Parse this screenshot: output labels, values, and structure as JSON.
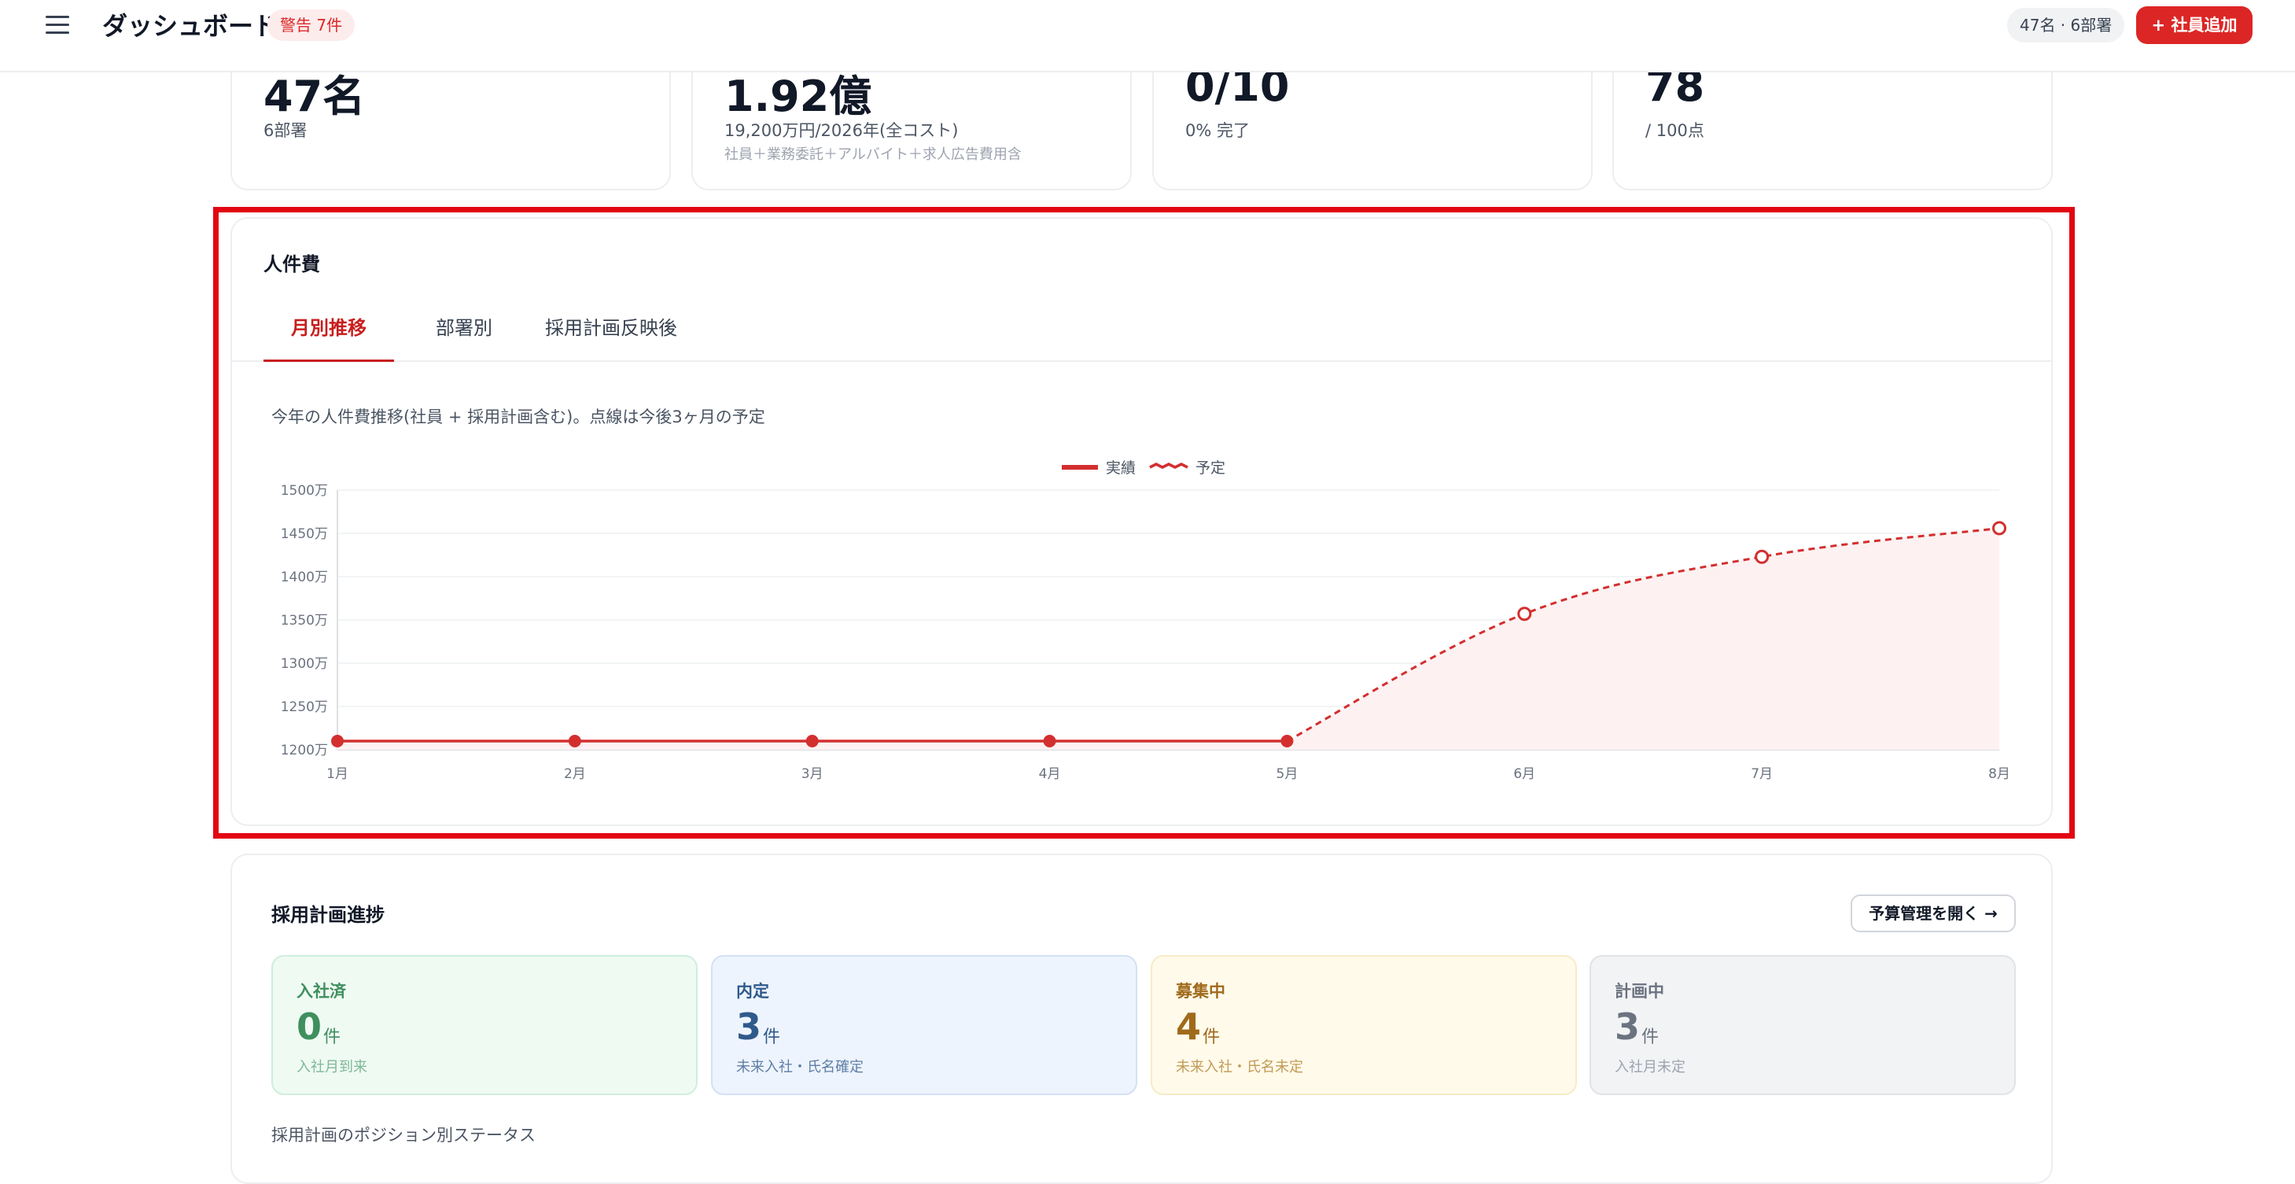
{
  "header": {
    "title": "ダッシュボード",
    "warning_badge": "警告 7件",
    "org_summary": "47名 · 6部署",
    "add_employee_label": "+ 社員追加"
  },
  "stats": [
    {
      "value": "47名",
      "sub": "6部署",
      "note": ""
    },
    {
      "value": "1.92億",
      "sub": "19,200万円/2026年(全コスト)",
      "note": "社員＋業務委託＋アルバイト＋求人広告費用含"
    },
    {
      "value": "0/10",
      "sub": "0% 完了",
      "note": ""
    },
    {
      "value": "78",
      "sub": "/ 100点",
      "note": ""
    }
  ],
  "cost_panel": {
    "title": "人件費",
    "tabs": [
      "月別推移",
      "部署別",
      "採用計画反映後"
    ],
    "active_tab": 0,
    "description": "今年の人件費推移(社員 + 採用計画含む)。点線は今後3ヶ月の予定"
  },
  "colors": {
    "accent": "#d32f2f",
    "forecast_fill": "#fdf1f1",
    "hired": "#3f8f5e",
    "offer": "#2f5a8c",
    "recruiting": "#a06a1c",
    "planning": "#6b7280"
  },
  "chart_data": {
    "type": "line",
    "categories": [
      "1月",
      "2月",
      "3月",
      "4月",
      "5月",
      "6月",
      "7月",
      "8月"
    ],
    "series": [
      {
        "name": "実績",
        "values": [
          1210,
          1210,
          1210,
          1210,
          1210,
          null,
          null,
          null
        ],
        "style": "solid"
      },
      {
        "name": "予定",
        "values": [
          null,
          null,
          null,
          null,
          1210,
          1357,
          1423,
          1456
        ],
        "style": "dashed"
      }
    ],
    "y_ticks": [
      1200,
      1250,
      1300,
      1350,
      1400,
      1450,
      1500
    ],
    "y_tick_labels": [
      "1200万",
      "1250万",
      "1300万",
      "1350万",
      "1400万",
      "1450万",
      "1500万"
    ],
    "ylim": [
      1200,
      1500
    ],
    "legend_position": "top-center",
    "grid": true
  },
  "hiring": {
    "title": "採用計画進捗",
    "budget_button": "予算管理を開く →",
    "statuses": [
      {
        "label": "入社済",
        "count": "0",
        "unit": "件",
        "note": "入社月到来",
        "theme": "hired"
      },
      {
        "label": "内定",
        "count": "3",
        "unit": "件",
        "note": "未来入社・氏名確定",
        "theme": "offer"
      },
      {
        "label": "募集中",
        "count": "4",
        "unit": "件",
        "note": "未来入社・氏名未定",
        "theme": "recruiting"
      },
      {
        "label": "計画中",
        "count": "3",
        "unit": "件",
        "note": "入社月未定",
        "theme": "planning"
      }
    ],
    "position_status_label": "採用計画のポジション別ステータス"
  }
}
